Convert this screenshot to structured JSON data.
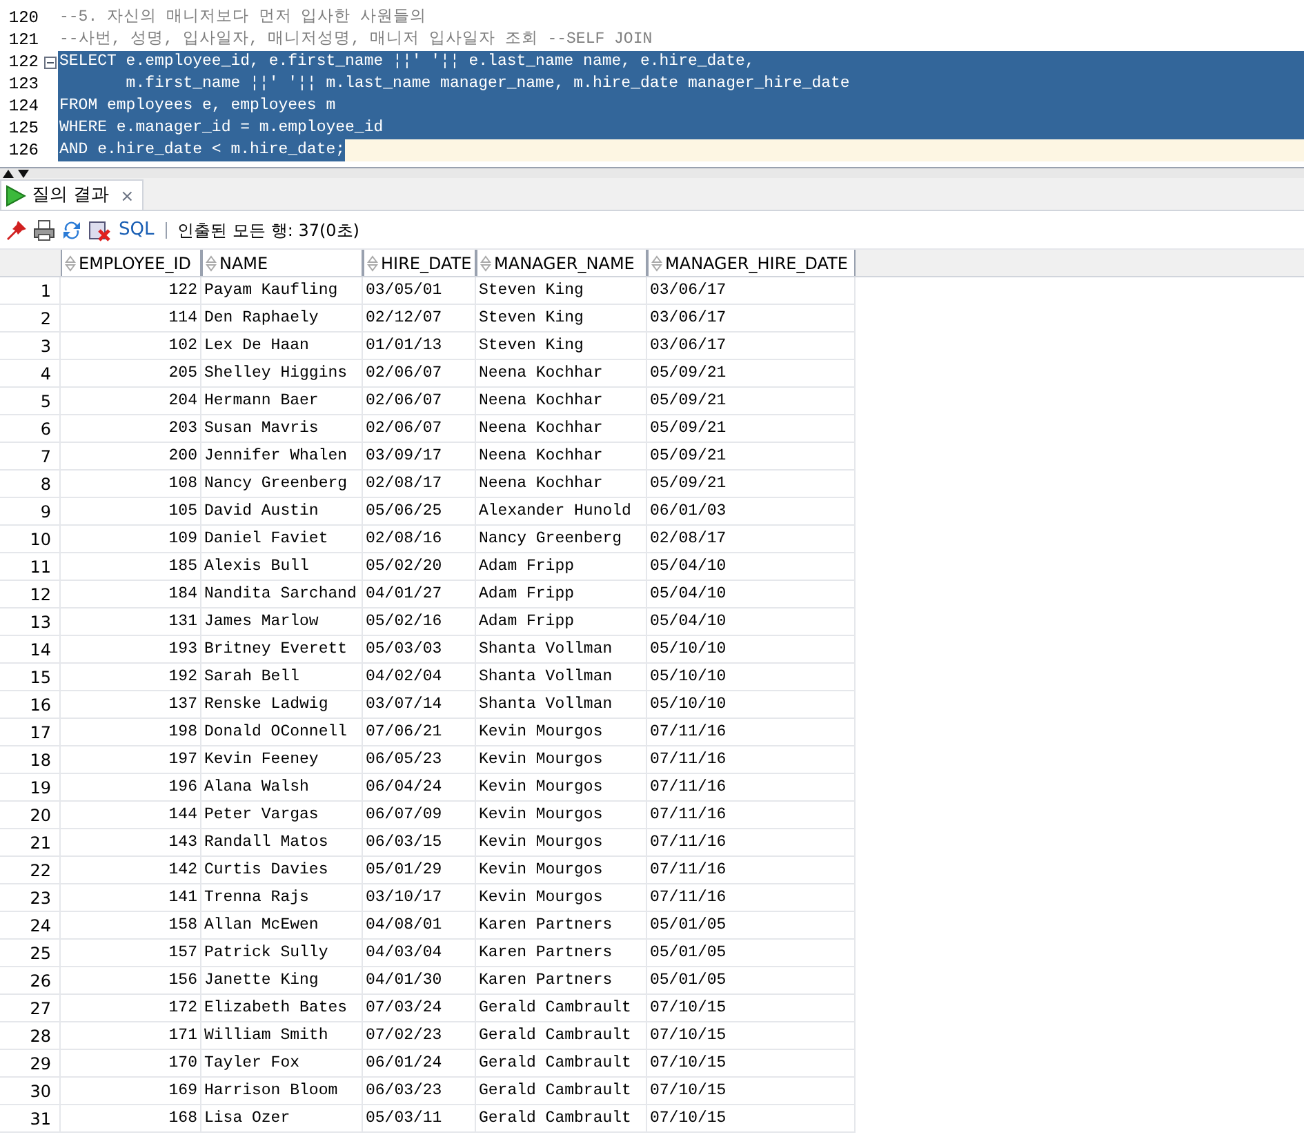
{
  "editor": {
    "lines": [
      {
        "number": "120",
        "kind": "comment",
        "text": "--5. 자신의 매니저보다 먼저 입사한 사원들의",
        "selected": false,
        "current": false,
        "fold": false
      },
      {
        "number": "121",
        "kind": "comment",
        "text": "--사번, 성명, 입사일자, 매니저성명, 매니저 입사일자 조회 --SELF JOIN",
        "selected": false,
        "current": false,
        "fold": false
      },
      {
        "number": "122",
        "kind": "code",
        "text": "SELECT e.employee_id, e.first_name ¦¦' '¦¦ e.last_name name, e.hire_date,",
        "selected": true,
        "current": false,
        "fold": true
      },
      {
        "number": "123",
        "kind": "code",
        "text": "       m.first_name ¦¦' '¦¦ m.last_name manager_name, m.hire_date manager_hire_date",
        "selected": true,
        "current": false,
        "fold": false
      },
      {
        "number": "124",
        "kind": "code",
        "text": "FROM employees e, employees m",
        "selected": true,
        "current": false,
        "fold": false
      },
      {
        "number": "125",
        "kind": "code",
        "text": "WHERE e.manager_id = m.employee_id",
        "selected": true,
        "current": false,
        "fold": false
      },
      {
        "number": "126",
        "kind": "code",
        "text": "AND e.hire_date < m.hire_date;",
        "selected": true,
        "current": true,
        "fold": false
      }
    ]
  },
  "results_tab": {
    "label": "질의 결과",
    "close": "×",
    "selected": true
  },
  "toolbar": {
    "sql_link": "SQL",
    "status": "인출된 모든 행: 37(0초)"
  },
  "table": {
    "columns": [
      "EMPLOYEE_ID",
      "NAME",
      "HIRE_DATE",
      "MANAGER_NAME",
      "MANAGER_HIRE_DATE"
    ],
    "rows": [
      {
        "number": "1",
        "cells": [
          "122",
          "Payam Kaufling",
          "03/05/01",
          "Steven King",
          "03/06/17"
        ]
      },
      {
        "number": "2",
        "cells": [
          "114",
          "Den Raphaely",
          "02/12/07",
          "Steven King",
          "03/06/17"
        ]
      },
      {
        "number": "3",
        "cells": [
          "102",
          "Lex De Haan",
          "01/01/13",
          "Steven King",
          "03/06/17"
        ]
      },
      {
        "number": "4",
        "cells": [
          "205",
          "Shelley Higgins",
          "02/06/07",
          "Neena Kochhar",
          "05/09/21"
        ]
      },
      {
        "number": "5",
        "cells": [
          "204",
          "Hermann Baer",
          "02/06/07",
          "Neena Kochhar",
          "05/09/21"
        ]
      },
      {
        "number": "6",
        "cells": [
          "203",
          "Susan Mavris",
          "02/06/07",
          "Neena Kochhar",
          "05/09/21"
        ]
      },
      {
        "number": "7",
        "cells": [
          "200",
          "Jennifer Whalen",
          "03/09/17",
          "Neena Kochhar",
          "05/09/21"
        ]
      },
      {
        "number": "8",
        "cells": [
          "108",
          "Nancy Greenberg",
          "02/08/17",
          "Neena Kochhar",
          "05/09/21"
        ]
      },
      {
        "number": "9",
        "cells": [
          "105",
          "David Austin",
          "05/06/25",
          "Alexander Hunold",
          "06/01/03"
        ]
      },
      {
        "number": "10",
        "cells": [
          "109",
          "Daniel Faviet",
          "02/08/16",
          "Nancy Greenberg",
          "02/08/17"
        ]
      },
      {
        "number": "11",
        "cells": [
          "185",
          "Alexis Bull",
          "05/02/20",
          "Adam Fripp",
          "05/04/10"
        ]
      },
      {
        "number": "12",
        "cells": [
          "184",
          "Nandita Sarchand",
          "04/01/27",
          "Adam Fripp",
          "05/04/10"
        ]
      },
      {
        "number": "13",
        "cells": [
          "131",
          "James Marlow",
          "05/02/16",
          "Adam Fripp",
          "05/04/10"
        ]
      },
      {
        "number": "14",
        "cells": [
          "193",
          "Britney Everett",
          "05/03/03",
          "Shanta Vollman",
          "05/10/10"
        ]
      },
      {
        "number": "15",
        "cells": [
          "192",
          "Sarah Bell",
          "04/02/04",
          "Shanta Vollman",
          "05/10/10"
        ]
      },
      {
        "number": "16",
        "cells": [
          "137",
          "Renske Ladwig",
          "03/07/14",
          "Shanta Vollman",
          "05/10/10"
        ]
      },
      {
        "number": "17",
        "cells": [
          "198",
          "Donald OConnell",
          "07/06/21",
          "Kevin Mourgos",
          "07/11/16"
        ]
      },
      {
        "number": "18",
        "cells": [
          "197",
          "Kevin Feeney",
          "06/05/23",
          "Kevin Mourgos",
          "07/11/16"
        ]
      },
      {
        "number": "19",
        "cells": [
          "196",
          "Alana Walsh",
          "06/04/24",
          "Kevin Mourgos",
          "07/11/16"
        ]
      },
      {
        "number": "20",
        "cells": [
          "144",
          "Peter Vargas",
          "06/07/09",
          "Kevin Mourgos",
          "07/11/16"
        ]
      },
      {
        "number": "21",
        "cells": [
          "143",
          "Randall Matos",
          "06/03/15",
          "Kevin Mourgos",
          "07/11/16"
        ]
      },
      {
        "number": "22",
        "cells": [
          "142",
          "Curtis Davies",
          "05/01/29",
          "Kevin Mourgos",
          "07/11/16"
        ]
      },
      {
        "number": "23",
        "cells": [
          "141",
          "Trenna Rajs",
          "03/10/17",
          "Kevin Mourgos",
          "07/11/16"
        ]
      },
      {
        "number": "24",
        "cells": [
          "158",
          "Allan McEwen",
          "04/08/01",
          "Karen Partners",
          "05/01/05"
        ]
      },
      {
        "number": "25",
        "cells": [
          "157",
          "Patrick Sully",
          "04/03/04",
          "Karen Partners",
          "05/01/05"
        ]
      },
      {
        "number": "26",
        "cells": [
          "156",
          "Janette King",
          "04/01/30",
          "Karen Partners",
          "05/01/05"
        ]
      },
      {
        "number": "27",
        "cells": [
          "172",
          "Elizabeth Bates",
          "07/03/24",
          "Gerald Cambrault",
          "07/10/15"
        ]
      },
      {
        "number": "28",
        "cells": [
          "171",
          "William Smith",
          "07/02/23",
          "Gerald Cambrault",
          "07/10/15"
        ]
      },
      {
        "number": "29",
        "cells": [
          "170",
          "Tayler Fox",
          "06/01/24",
          "Gerald Cambrault",
          "07/10/15"
        ]
      },
      {
        "number": "30",
        "cells": [
          "169",
          "Harrison Bloom",
          "06/03/23",
          "Gerald Cambrault",
          "07/10/15"
        ]
      },
      {
        "number": "31",
        "cells": [
          "168",
          "Lisa Ozer",
          "05/03/11",
          "Gerald Cambrault",
          "07/10/15"
        ]
      }
    ]
  }
}
